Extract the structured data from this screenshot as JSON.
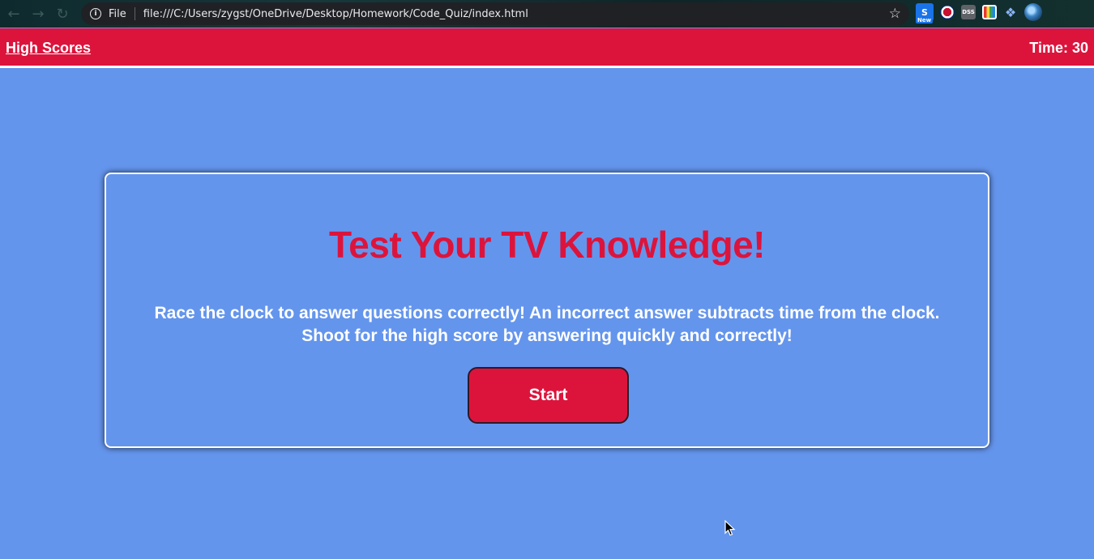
{
  "browser": {
    "info_icon": "info-icon",
    "file_label": "File",
    "url": "file:///C:/Users/zygst/OneDrive/Desktop/Homework/Code_Quiz/index.html",
    "star_icon": "star-icon",
    "extensions": [
      {
        "name": "s-new-extension",
        "label": "S",
        "badge": "New"
      },
      {
        "name": "flag-extension"
      },
      {
        "name": "dss-extension",
        "label": "DSS"
      },
      {
        "name": "book-extension"
      },
      {
        "name": "puzzle-extension"
      },
      {
        "name": "profile-avatar"
      }
    ]
  },
  "header": {
    "high_scores_label": "High Scores",
    "timer_label": "Time: 30"
  },
  "quiz": {
    "title": "Test Your TV Knowledge!",
    "description": "Race the clock to answer questions correctly! An incorrect answer subtracts time from the clock. Shoot for the high score by answering quickly and correctly!",
    "start_label": "Start"
  },
  "colors": {
    "background": "#6495ed",
    "accent": "#dc143c",
    "text": "#ffffff"
  }
}
